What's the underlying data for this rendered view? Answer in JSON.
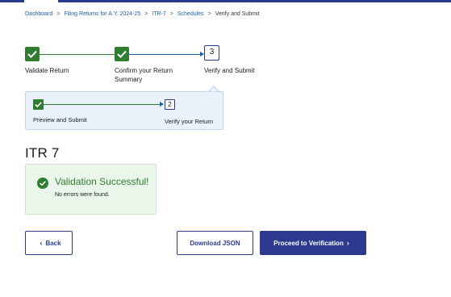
{
  "breadcrumb": {
    "items": [
      "Dashboard",
      "Filing Returns for A.Y. 2024-25",
      "ITR-7",
      "Schedules"
    ],
    "current": "Verify and Submit",
    "separator": ">"
  },
  "stepper": {
    "steps": [
      {
        "label": "Validate Return",
        "status": "done"
      },
      {
        "label_line1": "Confirm your Return",
        "label_line2": "Summary",
        "status": "done"
      },
      {
        "number": "3",
        "label": "Verify and Submit",
        "status": "active"
      }
    ]
  },
  "sub_stepper": {
    "steps": [
      {
        "label": "Preview and Submit",
        "status": "done"
      },
      {
        "number": "2",
        "label": "Verify your Return",
        "status": "active"
      }
    ]
  },
  "form_title": "ITR 7",
  "validation": {
    "title": "Validation Successful!",
    "message": "No errors were found."
  },
  "buttons": {
    "back": {
      "label": "Back",
      "icon": "chevron-left-icon"
    },
    "download": {
      "label": "Download JSON"
    },
    "proceed": {
      "label": "Proceed to Verification",
      "icon": "chevron-right-icon"
    }
  },
  "colors": {
    "primary": "#2b3a8f",
    "success": "#2f7d32",
    "link": "#1d5fa8",
    "panel_bg": "#e9f1fb",
    "success_bg": "#eaf6ea"
  }
}
